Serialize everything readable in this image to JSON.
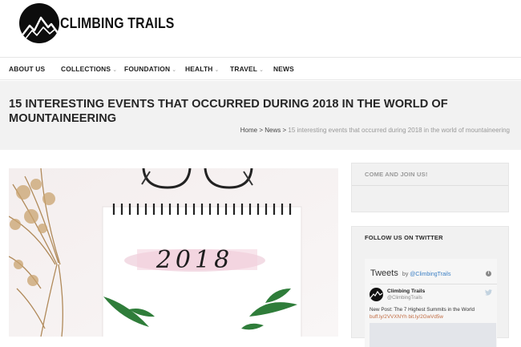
{
  "header": {
    "logo_text": "CLIMBING TRAILS"
  },
  "nav": {
    "items": [
      {
        "label": "ABOUT US",
        "has_dropdown": false
      },
      {
        "label": "COLLECTIONS",
        "has_dropdown": true
      },
      {
        "label": "FOUNDATION",
        "has_dropdown": true
      },
      {
        "label": "HEALTH",
        "has_dropdown": true
      },
      {
        "label": "TRAVEL",
        "has_dropdown": true
      },
      {
        "label": "NEWS",
        "has_dropdown": false
      }
    ],
    "chevron": "⌄"
  },
  "page": {
    "title": "15 INTERESTING EVENTS THAT OCCURRED DURING 2018 IN THE WORLD OF MOUNTAINEERING",
    "breadcrumb": {
      "home": "Home",
      "sep": ">",
      "section": "News",
      "current": "15 interesting events that occurred during 2018 in the world of mountaineering"
    }
  },
  "hero": {
    "notepad_text": "2018",
    "icons": [
      "spiral-notepad",
      "eyeglasses",
      "dried-flowers",
      "green-leaves"
    ]
  },
  "sidebar": {
    "join_widget": {
      "title": "COME AND JOIN US!"
    },
    "twitter_widget": {
      "title": "FOLLOW US ON TWITTER",
      "feed_title": "Tweets",
      "by_label": "by",
      "by_handle": "@ClimbingTrails",
      "tweet": {
        "author": "Climbing Trails",
        "handle": "@ClimbingTrails",
        "text": "New Post: The 7 Highest Summits in the World",
        "links": "buff.ly/2VVXNYh bit.ly/2GwVd5w"
      }
    }
  },
  "colors": {
    "title_band": "#f2f2f2",
    "sidebar_bg": "#f1f1f1",
    "link_blue": "#3b7fc4",
    "tweet_link": "#c06a40"
  }
}
